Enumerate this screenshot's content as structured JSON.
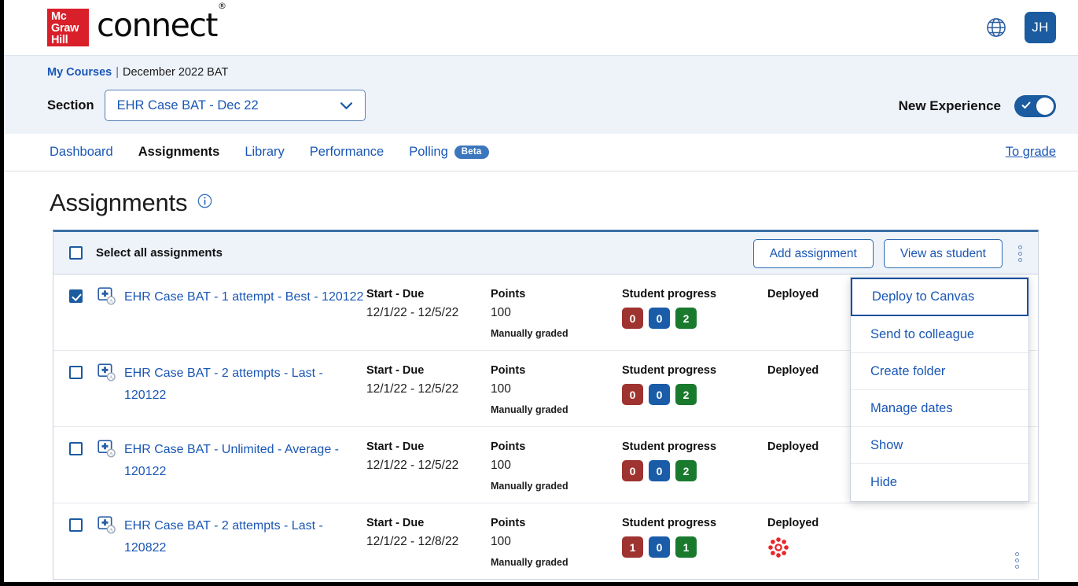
{
  "brand": {
    "mcgraw_line1": "Mc",
    "mcgraw_line2": "Graw",
    "mcgraw_line3": "Hill",
    "product": "connect",
    "trademark": "®",
    "globe_icon": "globe-icon",
    "avatar_initials": "JH"
  },
  "course": {
    "breadcrumb_link": "My Courses",
    "breadcrumb_separator": "|",
    "breadcrumb_current": "December 2022 BAT",
    "section_label": "Section",
    "section_value": "EHR Case BAT - Dec 22",
    "new_experience_label": "New Experience",
    "new_experience_on": true
  },
  "nav": {
    "tabs": [
      {
        "label": "Dashboard",
        "active": false,
        "badge": ""
      },
      {
        "label": "Assignments",
        "active": true,
        "badge": ""
      },
      {
        "label": "Library",
        "active": false,
        "badge": ""
      },
      {
        "label": "Performance",
        "active": false,
        "badge": ""
      },
      {
        "label": "Polling",
        "active": false,
        "badge": "Beta"
      }
    ],
    "to_grade": "To grade"
  },
  "page": {
    "title": "Assignments",
    "info_icon": "info-icon"
  },
  "toolbar": {
    "select_all_label": "Select all assignments",
    "add_assignment_label": "Add assignment",
    "view_as_student_label": "View as student",
    "overflow_icon": "kebab-menu-icon"
  },
  "columns": {
    "dates": "Start - Due",
    "points": "Points",
    "progress": "Student progress",
    "status": "Deployed"
  },
  "colors": {
    "brand_red": "#d81f2a",
    "link_blue": "#1a57b5",
    "accent_blue": "#1b5ba0",
    "badge_red": "#9e3330",
    "badge_blue": "#1a5ca8",
    "badge_green": "#197a2e",
    "canvas_red": "#e8262a"
  },
  "rows": [
    {
      "selected": true,
      "icon": "ehr-case-icon",
      "name": "EHR Case BAT - 1 attempt - Best - 120122",
      "dates_header": "Start - Due",
      "dates": "12/1/22 - 12/5/22",
      "points_header": "Points",
      "points": "100",
      "grading": "Manually graded",
      "progress_header": "Student progress",
      "badges": [
        {
          "value": "0",
          "color": "#9e3330"
        },
        {
          "value": "0",
          "color": "#1a5ca8"
        },
        {
          "value": "2",
          "color": "#197a2e"
        }
      ],
      "status_header": "Deployed",
      "status_icon": "canvas-logo-icon",
      "status_icon_visible": false
    },
    {
      "selected": false,
      "icon": "ehr-case-icon",
      "name": "EHR Case BAT - 2 attempts - Last - 120122",
      "dates_header": "Start - Due",
      "dates": "12/1/22 - 12/5/22",
      "points_header": "Points",
      "points": "100",
      "grading": "Manually graded",
      "progress_header": "Student progress",
      "badges": [
        {
          "value": "0",
          "color": "#9e3330"
        },
        {
          "value": "0",
          "color": "#1a5ca8"
        },
        {
          "value": "2",
          "color": "#197a2e"
        }
      ],
      "status_header": "Deployed",
      "status_icon": "canvas-logo-icon",
      "status_icon_visible": false
    },
    {
      "selected": false,
      "icon": "ehr-case-icon",
      "name": "EHR Case BAT - Unlimited - Average - 120122",
      "dates_header": "Start - Due",
      "dates": "12/1/22 - 12/5/22",
      "points_header": "Points",
      "points": "100",
      "grading": "Manually graded",
      "progress_header": "Student progress",
      "badges": [
        {
          "value": "0",
          "color": "#9e3330"
        },
        {
          "value": "0",
          "color": "#1a5ca8"
        },
        {
          "value": "2",
          "color": "#197a2e"
        }
      ],
      "status_header": "Deployed",
      "status_icon": "canvas-logo-icon",
      "status_icon_visible": false
    },
    {
      "selected": false,
      "icon": "ehr-case-icon",
      "name": "EHR Case BAT - 2 attempts - Last - 120822",
      "dates_header": "Start - Due",
      "dates": "12/1/22 - 12/8/22",
      "points_header": "Points",
      "points": "100",
      "grading": "Manually graded",
      "progress_header": "Student progress",
      "badges": [
        {
          "value": "1",
          "color": "#9e3330"
        },
        {
          "value": "0",
          "color": "#1a5ca8"
        },
        {
          "value": "1",
          "color": "#197a2e"
        }
      ],
      "status_header": "Deployed",
      "status_icon": "canvas-logo-icon",
      "status_icon_visible": true
    }
  ],
  "dropdown": {
    "items": [
      {
        "label": "Deploy to Canvas",
        "focused": true
      },
      {
        "label": "Send to colleague",
        "focused": false
      },
      {
        "label": "Create folder",
        "focused": false
      },
      {
        "label": "Manage dates",
        "focused": false
      },
      {
        "label": "Show",
        "focused": false
      },
      {
        "label": "Hide",
        "focused": false
      }
    ]
  }
}
